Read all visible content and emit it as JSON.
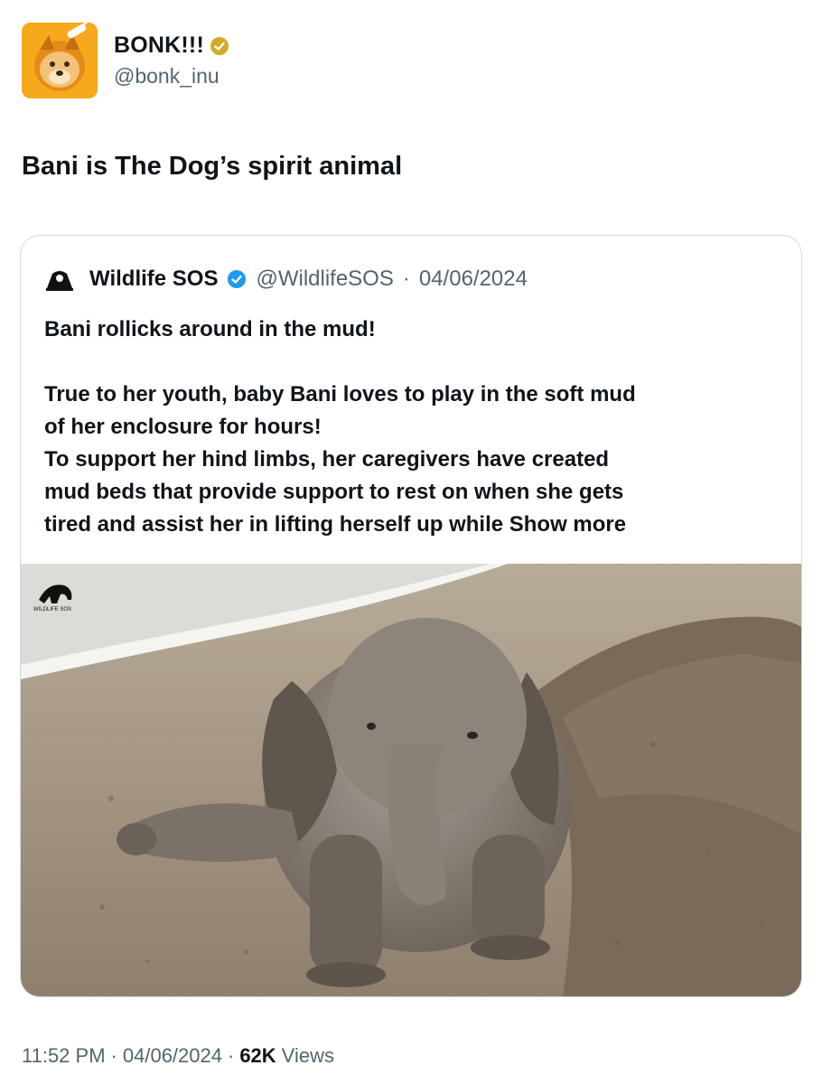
{
  "author": {
    "display_name": "BONK!!!",
    "handle": "@bonk_inu",
    "avatar_icon": "bonk-dog-avatar",
    "verified_color": "#d4a82a"
  },
  "tweet": {
    "text": "Bani is The Dog’s spirit animal"
  },
  "quoted": {
    "display_name": "Wildlife SOS",
    "handle": "@WildlifeSOS",
    "separator": "·",
    "date": "04/06/2024",
    "verified_color": "#1d9bf0",
    "lines": [
      "Bani rollicks around in the mud!",
      "True to her youth, baby Bani loves to play in the soft mud",
      "of her enclosure for hours!",
      "To support her hind limbs, her caregivers have created",
      "mud beds that provide support to rest on when she gets",
      "tired and assist her in lifting herself up while"
    ],
    "show_more": "Show more",
    "image_watermark": "WILDLIFE SOS"
  },
  "footer": {
    "time": "11:52 PM",
    "separator": "·",
    "date": "04/06/2024",
    "views_count": "62K",
    "views_label": "Views"
  }
}
